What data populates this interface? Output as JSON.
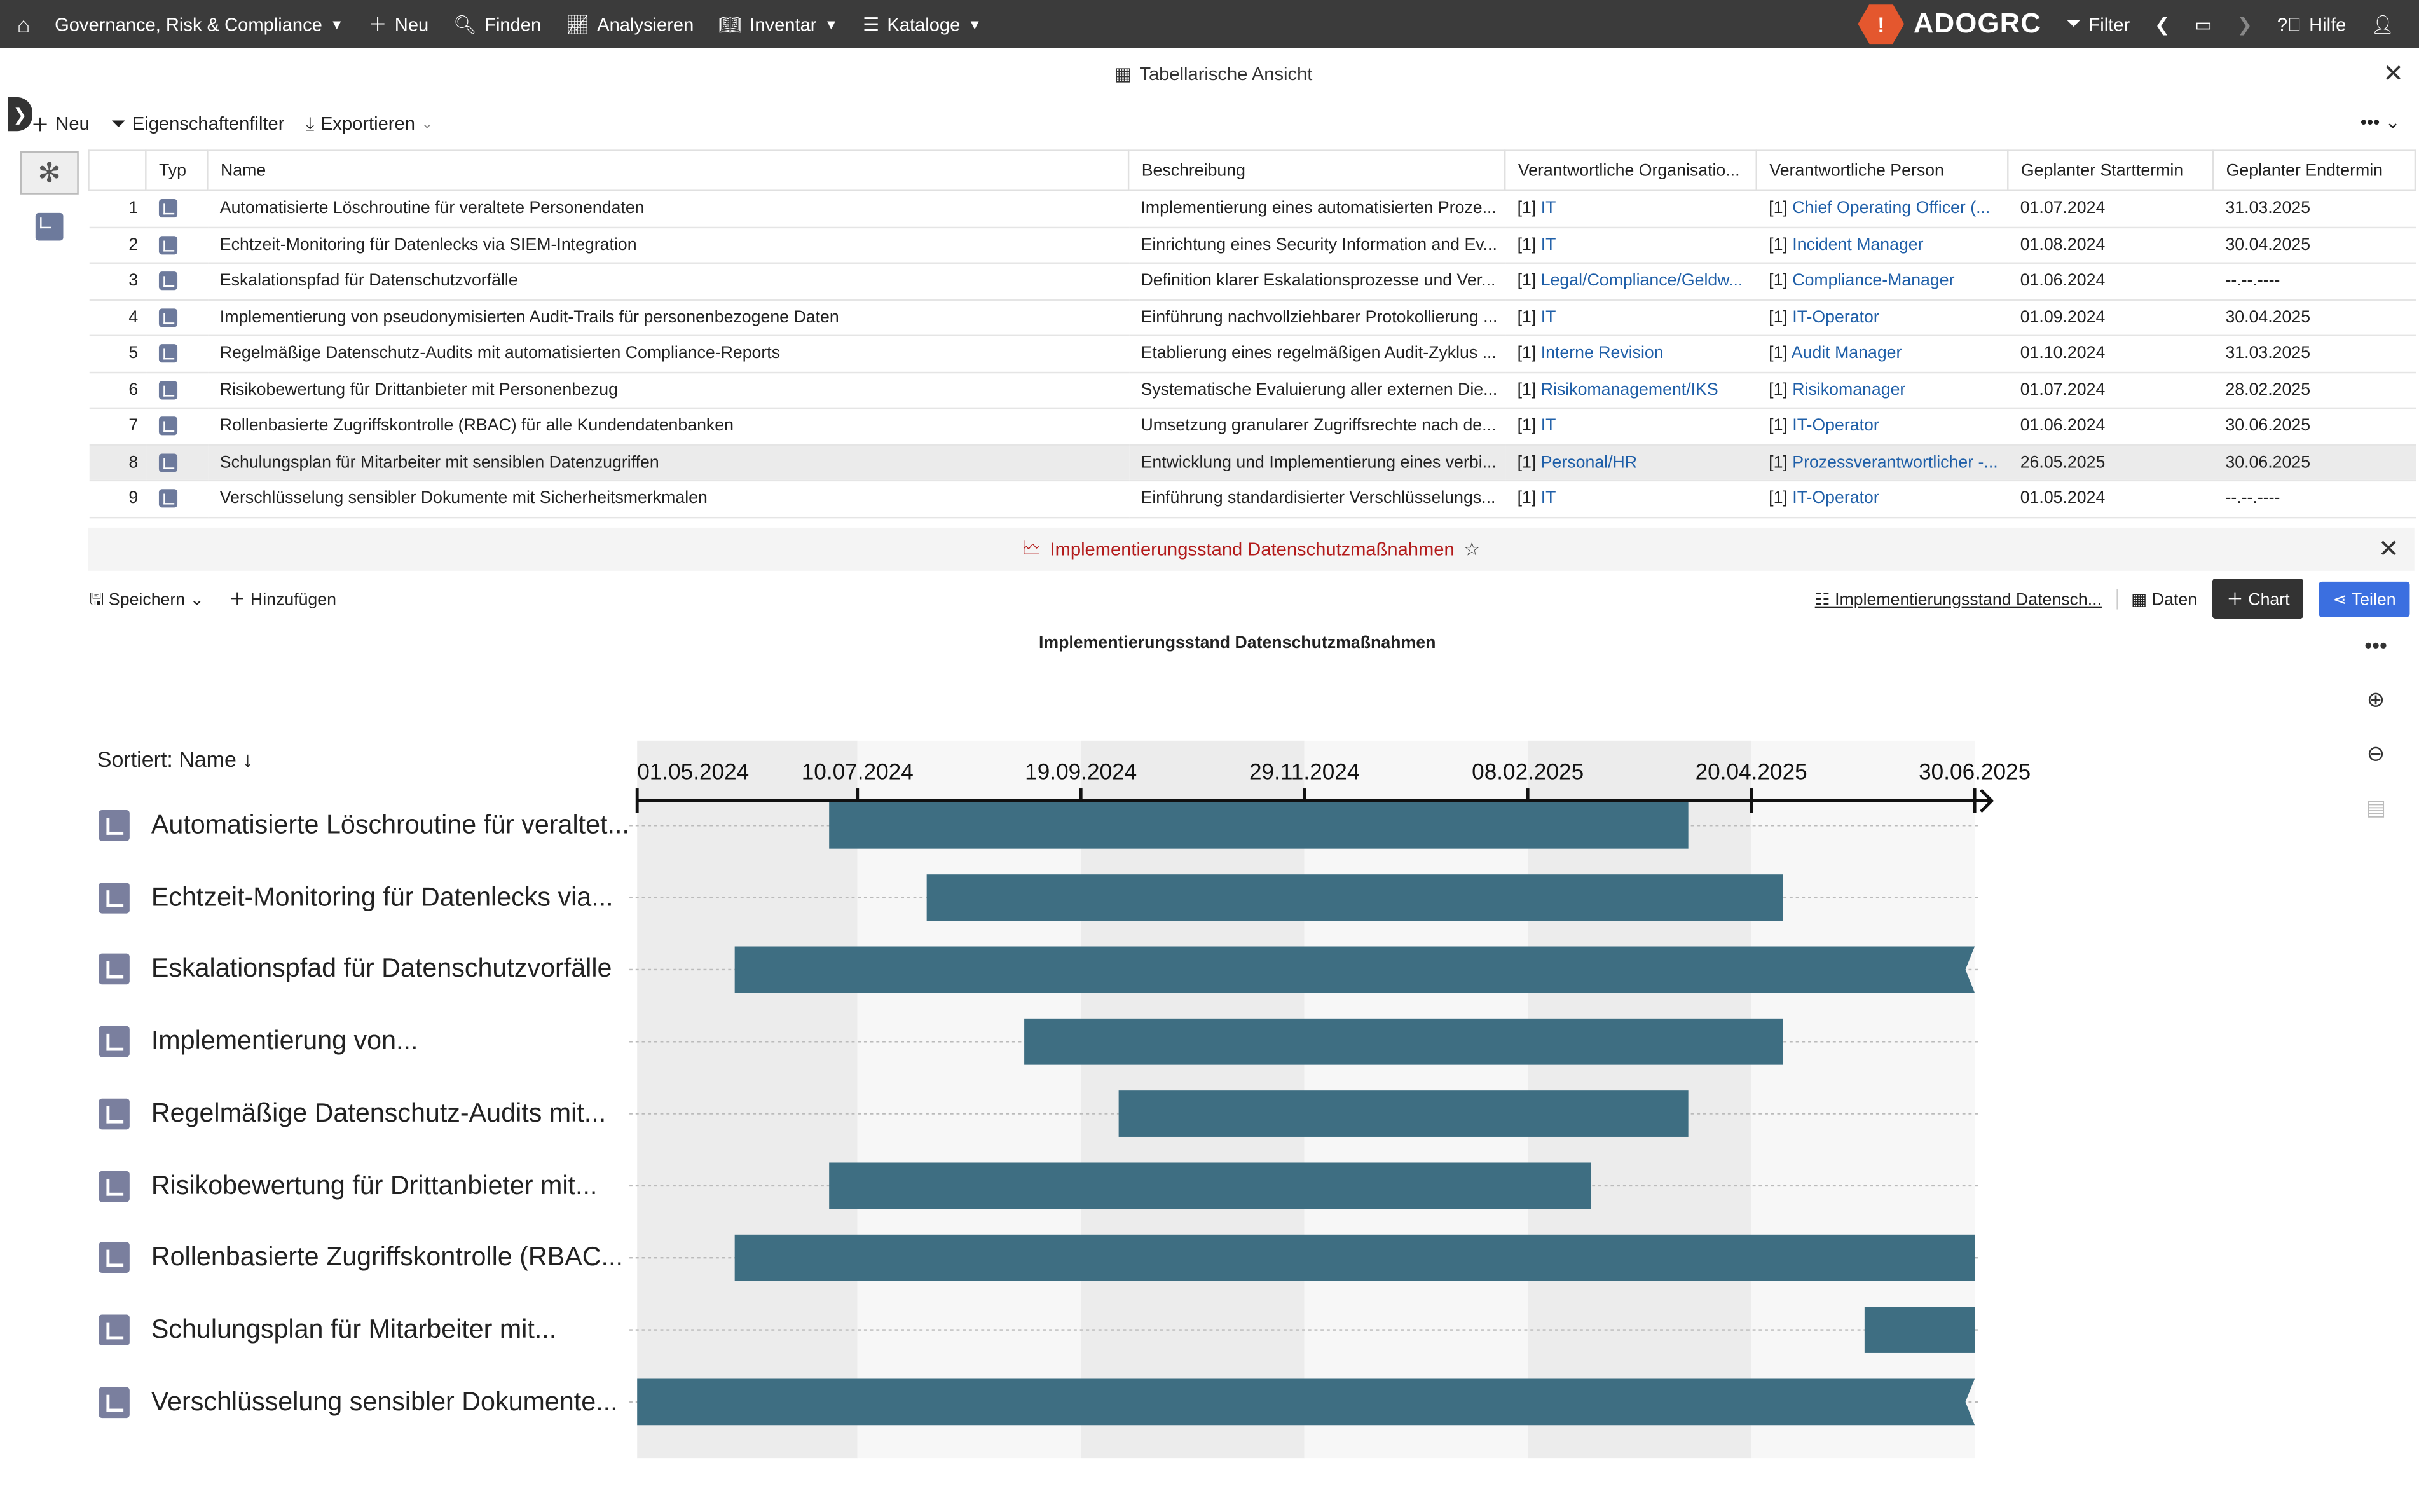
{
  "nav": {
    "items": [
      {
        "label": "Governance, Risk & Compliance",
        "icon": "chevron-down-icon"
      },
      {
        "label": "Neu",
        "icon": "plus-icon"
      },
      {
        "label": "Finden",
        "icon": "search-icon"
      },
      {
        "label": "Analysieren",
        "icon": "chart-icon"
      },
      {
        "label": "Inventar",
        "icon": "book-icon"
      },
      {
        "label": "Kataloge",
        "icon": "catalog-icon"
      }
    ],
    "brand": "ADOGRC",
    "filter_label": "Filter",
    "help_label": "Hilfe"
  },
  "table_panel": {
    "title": "Tabellarische Ansicht",
    "toolbar": {
      "new": "Neu",
      "property_filter": "Eigenschaftenfilter",
      "export": "Exportieren"
    },
    "columns": [
      "",
      "Typ",
      "Name",
      "Beschreibung",
      "Verantwortliche Organisatio...",
      "Verantwortliche Person",
      "Geplanter Starttermin",
      "Geplanter Endtermin"
    ],
    "rows": [
      {
        "n": "1",
        "name": "Automatisierte Löschroutine für veraltete Personendaten",
        "desc": "Implementierung eines automatisierten Proze...",
        "org_prefix": "[1]",
        "org": "IT",
        "person_prefix": "[1]",
        "person": "Chief Operating Officer (...",
        "start": "01.07.2024",
        "end": "31.03.2025"
      },
      {
        "n": "2",
        "name": "Echtzeit-Monitoring für Datenlecks via SIEM-Integration",
        "desc": "Einrichtung eines Security Information and Ev...",
        "org_prefix": "[1]",
        "org": "IT",
        "person_prefix": "[1]",
        "person": "Incident Manager",
        "start": "01.08.2024",
        "end": "30.04.2025"
      },
      {
        "n": "3",
        "name": "Eskalationspfad für Datenschutzvorfälle",
        "desc": "Definition klarer Eskalationsprozesse und Ver...",
        "org_prefix": "[1]",
        "org": "Legal/Compliance/Geldw...",
        "person_prefix": "[1]",
        "person": "Compliance-Manager",
        "start": "01.06.2024",
        "end": "--.--.----"
      },
      {
        "n": "4",
        "name": "Implementierung von pseudonymisierten Audit-Trails für personenbezogene Daten",
        "desc": "Einführung nachvollziehbarer Protokollierung ...",
        "org_prefix": "[1]",
        "org": "IT",
        "person_prefix": "[1]",
        "person": "IT-Operator",
        "start": "01.09.2024",
        "end": "30.04.2025"
      },
      {
        "n": "5",
        "name": "Regelmäßige Datenschutz-Audits mit automatisierten Compliance-Reports",
        "desc": "Etablierung eines regelmäßigen Audit-Zyklus ...",
        "org_prefix": "[1]",
        "org": "Interne Revision",
        "person_prefix": "[1]",
        "person": "Audit Manager",
        "start": "01.10.2024",
        "end": "31.03.2025"
      },
      {
        "n": "6",
        "name": "Risikobewertung für Drittanbieter mit Personenbezug",
        "desc": "Systematische Evaluierung aller externen Die...",
        "org_prefix": "[1]",
        "org": "Risikomanagement/IKS",
        "person_prefix": "[1]",
        "person": "Risikomanager",
        "start": "01.07.2024",
        "end": "28.02.2025"
      },
      {
        "n": "7",
        "name": "Rollenbasierte Zugriffskontrolle (RBAC) für alle Kundendatenbanken",
        "desc": "Umsetzung granularer Zugriffsrechte nach de...",
        "org_prefix": "[1]",
        "org": "IT",
        "person_prefix": "[1]",
        "person": "IT-Operator",
        "start": "01.06.2024",
        "end": "30.06.2025"
      },
      {
        "n": "8",
        "name": "Schulungsplan für Mitarbeiter mit sensiblen Datenzugriffen",
        "desc": "Entwicklung und Implementierung eines verbi...",
        "org_prefix": "[1]",
        "org": "Personal/HR",
        "person_prefix": "[1]",
        "person": "Prozessverantwortlicher -...",
        "start": "26.05.2025",
        "end": "30.06.2025"
      },
      {
        "n": "9",
        "name": "Verschlüsselung sensibler Dokumente mit Sicherheitsmerkmalen",
        "desc": "Einführung standardisierter Verschlüsselungs...",
        "org_prefix": "[1]",
        "org": "IT",
        "person_prefix": "[1]",
        "person": "IT-Operator",
        "start": "01.05.2024",
        "end": "--.--.----"
      }
    ],
    "selected_row": "8"
  },
  "chart_panel": {
    "title": "Implementierungsstand Datenschutzmaßnahmen",
    "save": "Speichern",
    "add": "Hinzufügen",
    "view_name": "Implementierungsstand Datensch...",
    "data_btn": "Daten",
    "chart_btn": "Chart",
    "share_btn": "Teilen",
    "sort_label": "Sortiert: Name"
  },
  "chart_data": {
    "type": "gantt",
    "title": "Implementierungsstand Datenschutzmaßnahmen",
    "x_range": [
      "2024-05-01",
      "2025-06-30"
    ],
    "ticks": [
      {
        "label": "01.05.2024",
        "date": "2024-05-01"
      },
      {
        "label": "10.07.2024",
        "date": "2024-07-10"
      },
      {
        "label": "19.09.2024",
        "date": "2024-09-19"
      },
      {
        "label": "29.11.2024",
        "date": "2024-11-29"
      },
      {
        "label": "08.02.2025",
        "date": "2025-02-08"
      },
      {
        "label": "20.04.2025",
        "date": "2025-04-20"
      },
      {
        "label": "30.06.2025",
        "date": "2025-06-30"
      }
    ],
    "bar_color": "#3e6e82",
    "tasks": [
      {
        "label": "Automatisierte Löschroutine für veraltet...",
        "start": "2024-07-01",
        "end": "2025-03-31",
        "open_end": false
      },
      {
        "label": "Echtzeit-Monitoring für Datenlecks via...",
        "start": "2024-08-01",
        "end": "2025-04-30",
        "open_end": false
      },
      {
        "label": "Eskalationspfad für Datenschutzvorfälle",
        "start": "2024-06-01",
        "end": "2025-06-30",
        "open_end": true
      },
      {
        "label": "Implementierung von...",
        "start": "2024-09-01",
        "end": "2025-04-30",
        "open_end": false
      },
      {
        "label": "Regelmäßige Datenschutz-Audits mit...",
        "start": "2024-10-01",
        "end": "2025-03-31",
        "open_end": false
      },
      {
        "label": "Risikobewertung für Drittanbieter mit...",
        "start": "2024-07-01",
        "end": "2025-02-28",
        "open_end": false
      },
      {
        "label": "Rollenbasierte Zugriffskontrolle (RBAC...",
        "start": "2024-06-01",
        "end": "2025-06-30",
        "open_end": false
      },
      {
        "label": "Schulungsplan für Mitarbeiter mit...",
        "start": "2025-05-26",
        "end": "2025-06-30",
        "open_end": false
      },
      {
        "label": "Verschlüsselung sensibler Dokumente...",
        "start": "2024-05-01",
        "end": "2025-06-30",
        "open_end": true
      }
    ]
  }
}
